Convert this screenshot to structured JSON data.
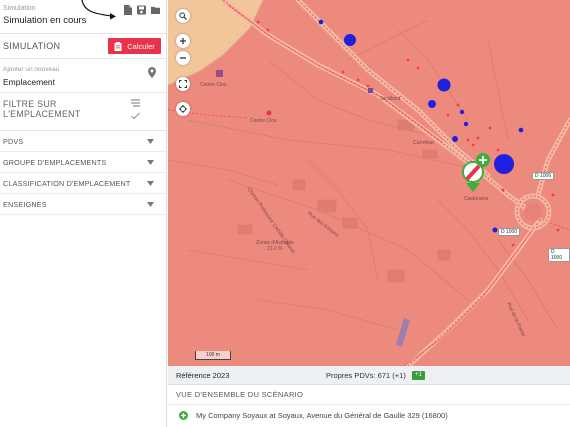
{
  "sidebar": {
    "simulation_label": "Simulation",
    "simulation_status": "Simulation en cours",
    "header_icons": [
      "file-icon",
      "save-icon",
      "folder-icon"
    ],
    "section_title": "SIMULATION",
    "calculate_button": "Calculer",
    "add_location_label": "Ajouter un nouveau",
    "add_location_value": "Emplacement",
    "filter_title": "FILTRE SUR L'EMPLACEMENT",
    "accordions": [
      {
        "label": "PDVS"
      },
      {
        "label": "GROUPE D'EMPLACEMENTS"
      },
      {
        "label": "CLASSIFICATION D'EMPLACEMENT"
      },
      {
        "label": "ENSEIGNES"
      }
    ]
  },
  "map": {
    "labels": {
      "centre_clos": "Centre Clos",
      "centre_clos_2": "Centre Clos",
      "jardiland": "Jardiland",
      "carrefour": "Carrefour",
      "castorama": "Castorama",
      "zone_activites": "Zones d'Activités\n21.2 %",
      "rue_artisans": "Rue des Artisans",
      "chemin_prof": "Chemin Professeur Camille Calanel",
      "rue_pointe": "Rue de la Pointe"
    },
    "road_numbers": [
      "D 1006",
      "D 1000",
      "D 1000"
    ],
    "scale_label": "100 m",
    "colors": {
      "zone": "#ec8a7e",
      "road": "#f0c2a8",
      "marker_blue": "#2020e0",
      "marker_green": "#3cae3c",
      "plus_green": "#3cae3c"
    }
  },
  "bottom": {
    "reference_title": "Référence 2023",
    "own_pdvs": "Propres PDVs: 671 (+1)",
    "delta_badge": "+1",
    "overview_title": "VUE D'ENSEMBLE DU SCÉNARIO",
    "store_line": "My Company Soyaux at Soyaux, Avenue du Général de Gaulle 329 (16800)"
  }
}
